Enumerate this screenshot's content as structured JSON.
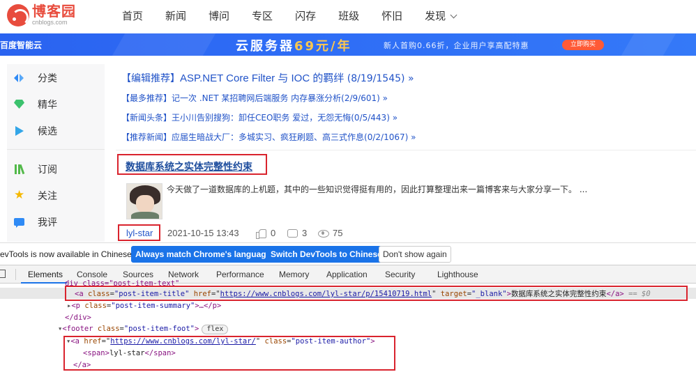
{
  "header": {
    "logo_title": "博客园",
    "logo_sub": "cnblogs.com",
    "nav": [
      "首页",
      "新闻",
      "博问",
      "专区",
      "闪存",
      "班级",
      "怀旧",
      "发现"
    ]
  },
  "banner": {
    "brand": "百度智能云",
    "main_prefix": "云服务器",
    "main_price": "69元/年",
    "sub": "新人首购0.66折，企业用户享高配特惠",
    "button": "立即购买"
  },
  "sidebar": {
    "items": [
      {
        "label": "分类",
        "icon": "category-icon"
      },
      {
        "label": "精华",
        "icon": "featured-icon"
      },
      {
        "label": "候选",
        "icon": "candidate-icon"
      },
      {
        "label": "订阅",
        "icon": "subscribe-icon"
      },
      {
        "label": "关注",
        "icon": "star-icon"
      },
      {
        "label": "我评",
        "icon": "comment-icon"
      }
    ]
  },
  "recommendations": [
    {
      "tag": "【编辑推荐】",
      "text": "ASP.NET Core Filter 与 IOC 的羁绊",
      "count": "(8/19/1545)",
      "arrow": "»"
    },
    {
      "tag": "【最多推荐】",
      "text": "记一次 .NET 某招聘网后端服务 内存暴涨分析",
      "count": "(2/9/601)",
      "arrow": "»"
    },
    {
      "tag": "【新闻头条】",
      "text": "王小川告别搜狗：卸任CEO职务 爱过，无怨无悔",
      "count": "(0/5/443)",
      "arrow": "»"
    },
    {
      "tag": "【推荐新闻】",
      "text": "应届生暗战大厂：多城实习、疯狂刷题、高三式作息",
      "count": "(0/2/1067)",
      "arrow": "»"
    }
  ],
  "post": {
    "title": "数据库系统之实体完整性约束",
    "summary": "今天做了一道数据库的上机题，其中的一些知识觉得挺有用的，因此打算整理出来一篇博客来与大家分享一下。 ...",
    "author": "lyl-star",
    "date": "2021-10-15 13:43",
    "likes": "0",
    "comments": "3",
    "views": "75"
  },
  "devtools": {
    "lang_message": "evTools is now available in Chinese!",
    "btn_match": "Always match Chrome's language",
    "btn_switch": "Switch DevTools to Chinese",
    "btn_dont": "Don't show again",
    "tabs": [
      "Elements",
      "Console",
      "Sources",
      "Network",
      "Performance",
      "Memory",
      "Application",
      "Security",
      "Lighthouse"
    ],
    "active_tab": "Elements",
    "tree": {
      "line0": "div class=\"post-item-text\"",
      "sel_tag_open": "<a",
      "sel_attr_class": "class",
      "sel_val_class": "\"post-item-title\"",
      "sel_attr_href": "href",
      "sel_val_href": "https://www.cnblogs.com/lyl-star/p/15410719.html",
      "sel_attr_target": "target",
      "sel_val_target": "\"_blank\"",
      "sel_text": "数据库系统之实体完整性约束",
      "sel_tag_close": "</a>",
      "sel_suffix": "== $0",
      "p_line_tag": "<p",
      "p_line_attr": "class",
      "p_line_val": "\"post-item-summary\"",
      "p_line_rest": ">…</p>",
      "div_close": "</div>",
      "footer_open": "<footer",
      "footer_attr": "class",
      "footer_val": "\"post-item-foot\"",
      "footer_end": ">",
      "flex_badge": "flex",
      "a2_open": "<a",
      "a2_href_attr": "href",
      "a2_href_val": "https://www.cnblogs.com/lyl-star/",
      "a2_class_attr": "class",
      "a2_class_val": "\"post-item-author\"",
      "a2_end": ">",
      "span_open": "<span>",
      "span_text": "lyl-star",
      "span_close": "</span>",
      "a2_close": "</a>"
    }
  },
  "colors": {
    "brand_red": "#e84c3d",
    "link_blue": "#2153c8",
    "annotation_red": "#d9232d",
    "devtools_blue": "#1a73e8"
  }
}
